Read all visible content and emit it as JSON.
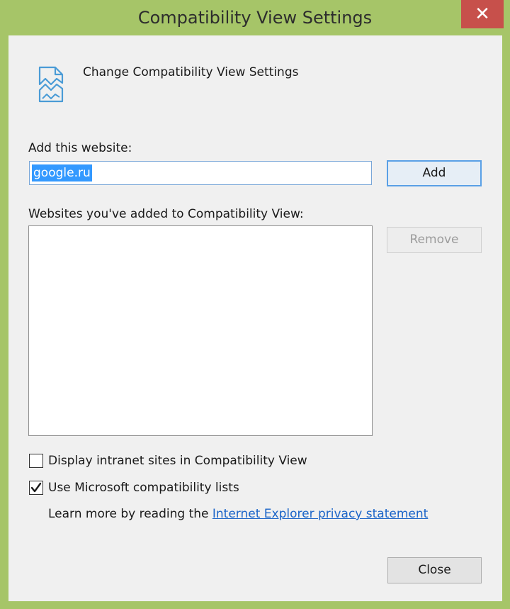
{
  "window": {
    "title": "Compatibility View Settings",
    "close_glyph": "✕"
  },
  "header": {
    "icon": "broken-page-icon",
    "text": "Change Compatibility View Settings"
  },
  "add_section": {
    "label": "Add this website:",
    "input_value": "google.ru",
    "add_button": "Add"
  },
  "list_section": {
    "label": "Websites you've added to Compatibility View:",
    "items": [],
    "remove_button": "Remove"
  },
  "options": {
    "intranet": {
      "label": "Display intranet sites in Compatibility View",
      "checked": false
    },
    "ms_lists": {
      "label": "Use Microsoft compatibility lists",
      "checked": true
    }
  },
  "learn_more": {
    "prefix": "Learn more by reading the ",
    "link": "Internet Explorer privacy statement"
  },
  "footer": {
    "close_button": "Close"
  },
  "colors": {
    "frame": "#a6c568",
    "close_red": "#c7504b",
    "selection": "#3399ff",
    "link": "#1a64c8"
  }
}
